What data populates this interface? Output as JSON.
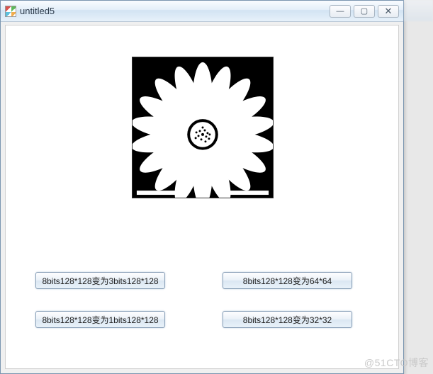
{
  "window": {
    "title": "untitled5",
    "controls": {
      "min": "—",
      "max": "▢",
      "close": "✕"
    }
  },
  "buttons": {
    "b1": "8bits128*128变为3bits128*128",
    "b2": "8bits128*128变为64*64",
    "b3": "8bits128*128变为1bits128*128",
    "b4": "8bits128*128变为32*32"
  },
  "watermark": "@51CTO博客"
}
